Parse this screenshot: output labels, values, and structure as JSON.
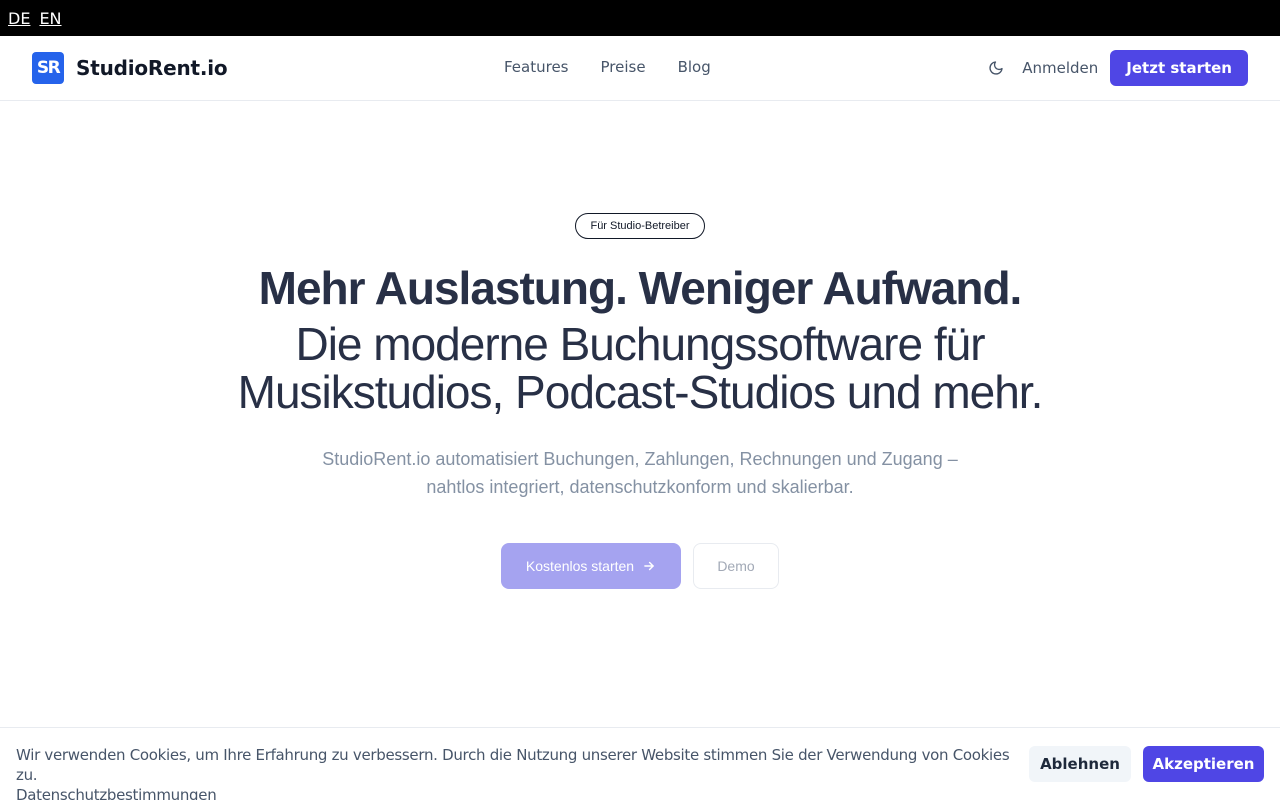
{
  "lang_bar": {
    "de": "DE",
    "en": "EN"
  },
  "header": {
    "logo_text": "SR",
    "brand": "StudioRent.io",
    "nav": [
      "Features",
      "Preise",
      "Blog"
    ],
    "theme_icon": "moon-icon",
    "signin": "Anmelden",
    "cta": "Jetzt starten"
  },
  "hero": {
    "badge": "Für Studio-Betreiber",
    "title_line1": "Mehr Auslastung. Weniger Aufwand.",
    "title_line2": "Die moderne Buchungssoftware für",
    "title_line3": "Musikstudios, Podcast-Studios und mehr.",
    "lead_line1": "StudioRent.io automatisiert Buchungen, Zahlungen, Rechnungen und Zugang –",
    "lead_line2": "nahtlos integriert, datenschutzkonform und skalierbar.",
    "primary_cta": "Kostenlos starten",
    "primary_cta_icon": "arrow-right-icon",
    "secondary_cta": "Demo"
  },
  "cookie_banner": {
    "text": "Wir verwenden Cookies, um Ihre Erfahrung zu verbessern. Durch die Nutzung unserer Website stimmen Sie der Verwendung von Cookies zu.",
    "link": "Datenschutzbestimmungen",
    "decline": "Ablehnen",
    "accept": "Akzeptieren"
  },
  "colors": {
    "accent": "#4f46e5",
    "logo_bg": "#2563eb",
    "primary_cta_faded": "#a5a3f0",
    "heading": "#283046",
    "muted_text": "#8491a3"
  }
}
